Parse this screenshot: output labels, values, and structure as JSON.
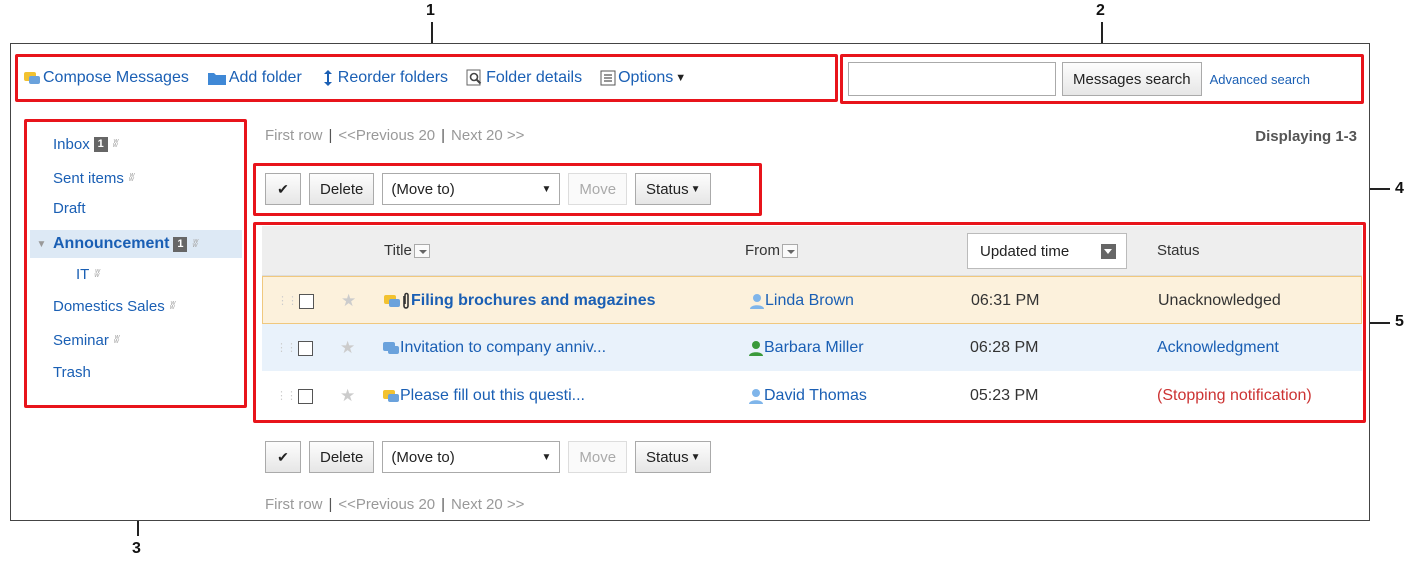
{
  "callouts": [
    "1",
    "2",
    "3",
    "4",
    "5"
  ],
  "toolbar": {
    "compose": "Compose Messages",
    "add_folder": "Add folder",
    "reorder": "Reorder folders",
    "details": "Folder details",
    "options": "Options"
  },
  "search": {
    "value": "",
    "button": "Messages search",
    "advanced": "Advanced search"
  },
  "sidebar": {
    "items": [
      {
        "label": "Inbox",
        "badge": "1"
      },
      {
        "label": "Sent items"
      },
      {
        "label": "Draft"
      },
      {
        "label": "Announcement",
        "badge": "1"
      },
      {
        "label": "IT"
      },
      {
        "label": "Domestics Sales"
      },
      {
        "label": "Seminar"
      },
      {
        "label": "Trash"
      }
    ]
  },
  "pager": {
    "first": "First row",
    "prev": "<<Previous 20",
    "next": "Next 20 >>",
    "displaying": "Displaying 1-3"
  },
  "actions": {
    "check": "✔",
    "delete": "Delete",
    "move_to": "(Move to)",
    "move": "Move",
    "status": "Status"
  },
  "table": {
    "headers": {
      "title": "Title",
      "from": "From",
      "updated": "Updated time",
      "status": "Status"
    },
    "rows": [
      {
        "title": "Filing brochures and magazines",
        "from": "Linda Brown",
        "time": "06:31 PM",
        "status": "Unacknowledged"
      },
      {
        "title": "Invitation to company anniv...",
        "from": "Barbara Miller",
        "time": "06:28 PM",
        "status": "Acknowledgment"
      },
      {
        "title": "Please fill out this questi...",
        "from": "David Thomas",
        "time": "05:23 PM",
        "status": "(Stopping notification)"
      }
    ]
  },
  "colors": {
    "link": "#1a5fb4",
    "callout_red": "#e8141b",
    "highlight_row": "#fcf1dc",
    "selected_row": "#e9f2fb",
    "stopping": "#cc3333"
  }
}
